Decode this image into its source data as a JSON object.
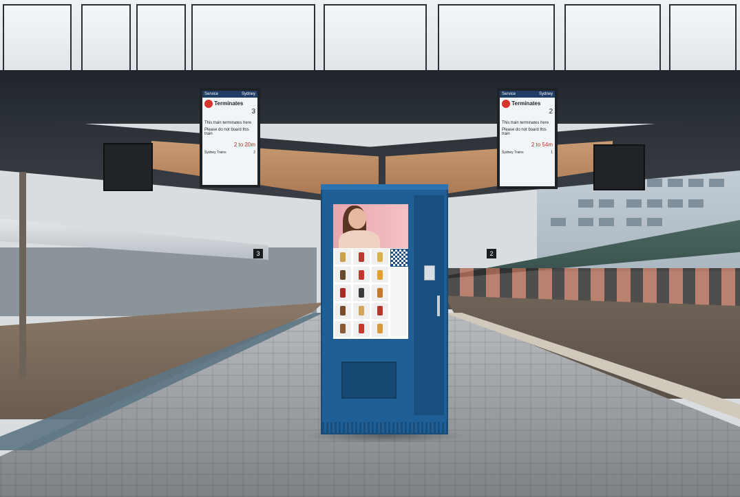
{
  "image": {
    "description_type": "photograph",
    "colors": {
      "kiosk": "#1f5f96",
      "sign_header": "#1f3d66",
      "stop_icon": "#d9332b"
    }
  },
  "signs": [
    {
      "header_left": "Service",
      "header_right": "Sydney",
      "title": "Terminates",
      "platform": "3",
      "line1": "This train terminates here",
      "line2": "Please do not board this train",
      "time": "2 to 20m",
      "footer_left": "Sydney Trains",
      "footer_right": "2"
    },
    {
      "header_left": "Service",
      "header_right": "Sydney",
      "title": "Terminates",
      "platform": "2",
      "line1": "This train terminates here",
      "line2": "Please do not board this train",
      "time": "2 to 54m",
      "footer_left": "Sydney Trains",
      "footer_right": "1"
    }
  ],
  "platform_numbers": [
    "3",
    "2"
  ]
}
